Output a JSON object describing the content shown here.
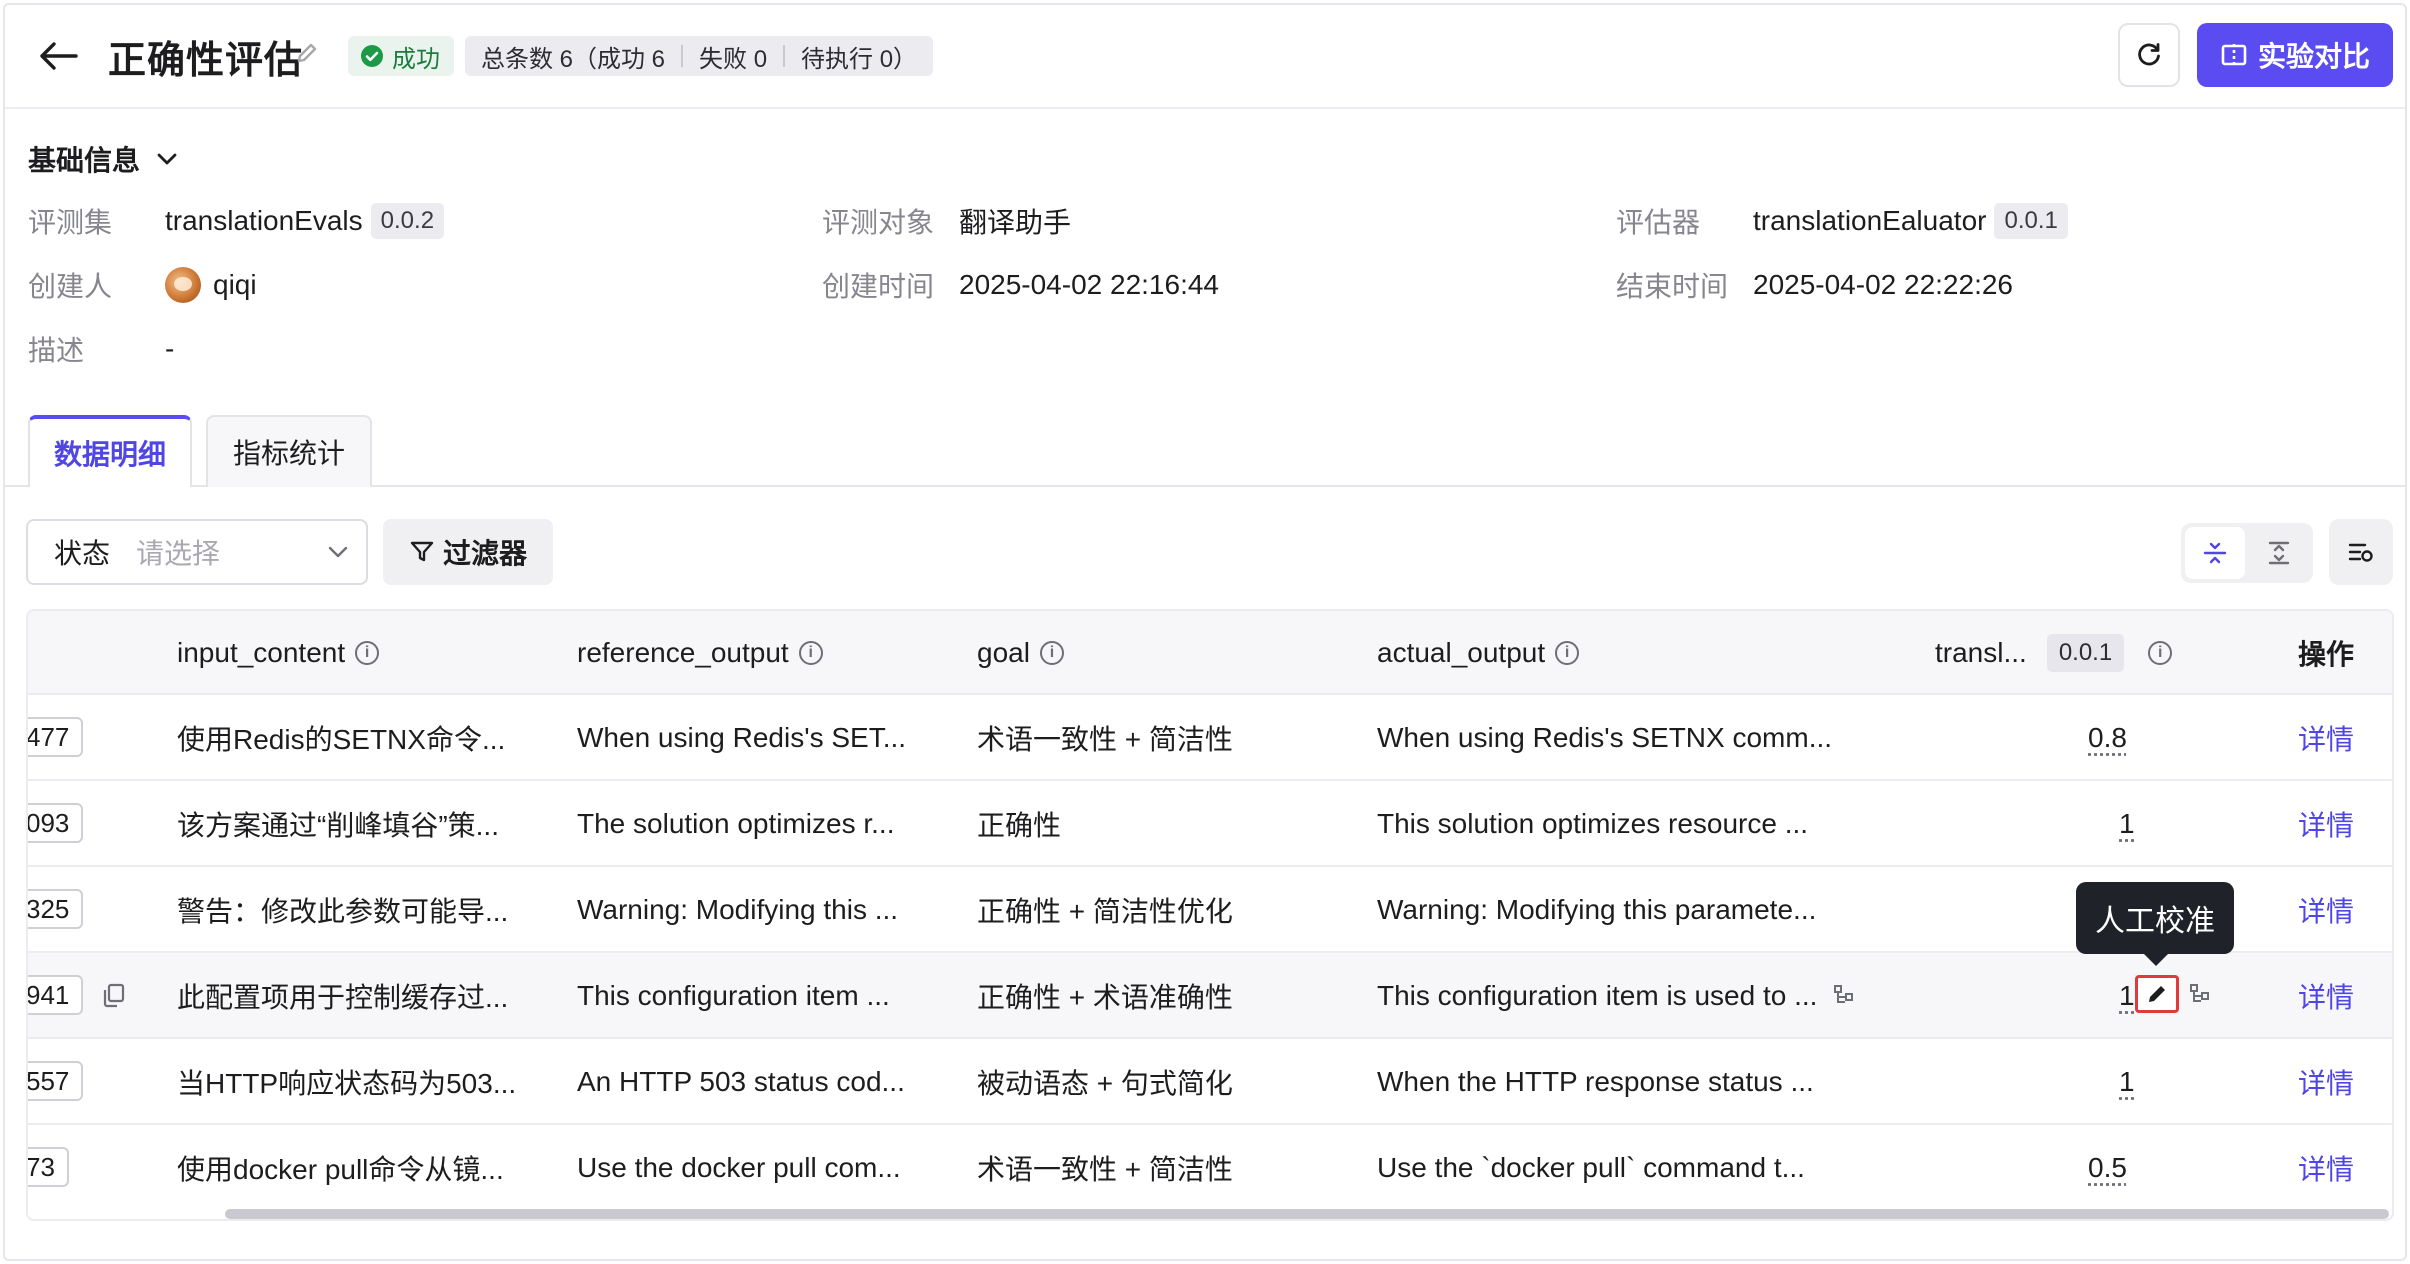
{
  "header": {
    "title": "正确性评估",
    "status": "成功",
    "total": "总条数 6（成功 6",
    "failed": "失败 0",
    "pending": "待执行 0）",
    "compare_label": "实验对比"
  },
  "basic_info": {
    "section_title": "基础信息",
    "eval_set_label": "评测集",
    "eval_set_value": "translationEvals",
    "eval_set_version": "0.0.2",
    "target_label": "评测对象",
    "target_value": "翻译助手",
    "evaluator_label": "评估器",
    "evaluator_value": "translationEaluator",
    "evaluator_version": "0.0.1",
    "creator_label": "创建人",
    "creator_value": "qiqi",
    "created_label": "创建时间",
    "created_value": "2025-04-02 22:16:44",
    "ended_label": "结束时间",
    "ended_value": "2025-04-02 22:22:26",
    "desc_label": "描述",
    "desc_value": "-"
  },
  "tabs": [
    {
      "label": "数据明细",
      "active": true
    },
    {
      "label": "指标统计",
      "active": false
    }
  ],
  "filters": {
    "status_label": "状态",
    "status_placeholder": "请选择",
    "filter_label": "过滤器"
  },
  "table": {
    "columns": {
      "input": "input_content",
      "reference": "reference_output",
      "goal": "goal",
      "actual": "actual_output",
      "evaluator": "transl...",
      "evaluator_version": "0.0.1",
      "actions": "操作"
    },
    "rows": [
      {
        "id": "477",
        "input": "使用Redis的SETNX命令...",
        "reference": "When using Redis's SET...",
        "goal": "术语一致性 + 简洁性",
        "actual": "When using Redis's SETNX comm...",
        "score": "0.8",
        "action": "详情"
      },
      {
        "id": "093",
        "input": "该方案通过“削峰填谷”策...",
        "reference": "The solution optimizes r...",
        "goal": "正确性",
        "actual": "This solution optimizes resource ...",
        "score": "1",
        "action": "详情"
      },
      {
        "id": "325",
        "input": "警告：修改此参数可能导...",
        "reference": "Warning: Modifying this ...",
        "goal": "正确性 + 简洁性优化",
        "actual": "Warning: Modifying this paramete...",
        "score": "",
        "action": "详情"
      },
      {
        "id": "941",
        "input": "此配置项用于控制缓存过...",
        "reference": "This configuration item ...",
        "goal": "正确性 + 术语准确性",
        "actual": "This configuration item is used to ...",
        "score": "1",
        "action": "详情"
      },
      {
        "id": "557",
        "input": "当HTTP响应状态码为503...",
        "reference": "An HTTP 503 status cod...",
        "goal": "被动语态 + 句式简化",
        "actual": "When the HTTP response status ...",
        "score": "1",
        "action": "详情"
      },
      {
        "id": "73",
        "input": "使用docker pull命令从镜...",
        "reference": "Use the docker pull com...",
        "goal": "术语一致性 + 简洁性",
        "actual": "Use the `docker pull` command t...",
        "score": "0.5",
        "action": "详情"
      }
    ]
  },
  "tooltip": "人工校准",
  "colors": {
    "accent": "#5a4cf0",
    "success": "#1c7c3c",
    "highlight": "#e23a3a"
  }
}
